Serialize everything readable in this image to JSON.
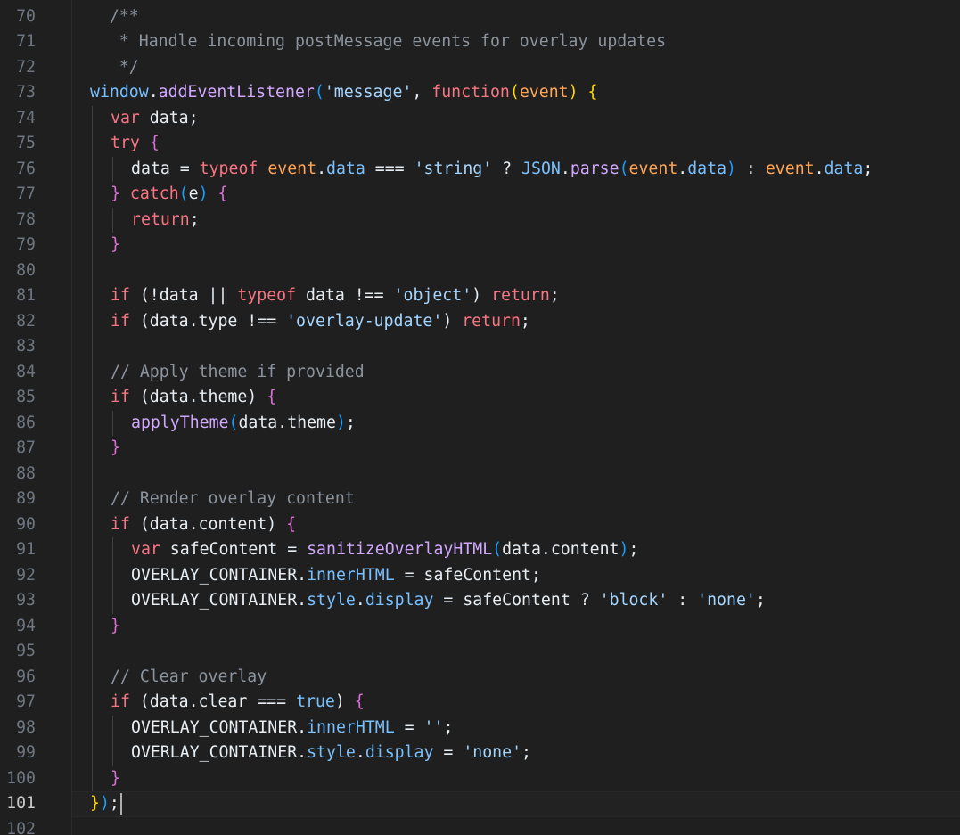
{
  "editor": {
    "lines": [
      {
        "n": "70",
        "indent": 0,
        "tokens": [
          {
            "t": "  /**",
            "c": "c-grey"
          }
        ]
      },
      {
        "n": "71",
        "indent": 0,
        "tokens": [
          {
            "t": "   * Handle incoming postMessage events for overlay updates",
            "c": "c-grey"
          }
        ]
      },
      {
        "n": "72",
        "indent": 0,
        "tokens": [
          {
            "t": "   */",
            "c": "c-grey"
          }
        ]
      },
      {
        "n": "73",
        "indent": 0,
        "tokens": [
          {
            "t": "window",
            "c": "tk-blue"
          },
          {
            "t": ".",
            "c": "tk-plain"
          },
          {
            "t": "addEventListener",
            "c": "fn-purple"
          },
          {
            "t": "(",
            "c": "b3"
          },
          {
            "t": "'message'",
            "c": "tk-str"
          },
          {
            "t": ", ",
            "c": "tk-plain"
          },
          {
            "t": "function",
            "c": "kw-red"
          },
          {
            "t": "(",
            "c": "b1"
          },
          {
            "t": "event",
            "c": "tk-orange"
          },
          {
            "t": ")",
            "c": "b1"
          },
          {
            "t": " ",
            "c": "tk-plain"
          },
          {
            "t": "{",
            "c": "b1"
          }
        ]
      },
      {
        "n": "74",
        "indent": 1,
        "tokens": [
          {
            "t": "var",
            "c": "kw-red"
          },
          {
            "t": " data;",
            "c": "tk-plain"
          }
        ]
      },
      {
        "n": "75",
        "indent": 1,
        "tokens": [
          {
            "t": "try",
            "c": "kw-red"
          },
          {
            "t": " ",
            "c": "tk-plain"
          },
          {
            "t": "{",
            "c": "b2"
          }
        ]
      },
      {
        "n": "76",
        "indent": 2,
        "tokens": [
          {
            "t": "data = ",
            "c": "tk-plain"
          },
          {
            "t": "typeof",
            "c": "kw-red"
          },
          {
            "t": " ",
            "c": "tk-plain"
          },
          {
            "t": "event",
            "c": "tk-orange"
          },
          {
            "t": ".",
            "c": "tk-plain"
          },
          {
            "t": "data",
            "c": "tk-blue"
          },
          {
            "t": " === ",
            "c": "tk-plain"
          },
          {
            "t": "'string'",
            "c": "tk-str"
          },
          {
            "t": " ? ",
            "c": "tk-plain"
          },
          {
            "t": "JSON",
            "c": "tk-blue"
          },
          {
            "t": ".",
            "c": "tk-plain"
          },
          {
            "t": "parse",
            "c": "fn-purple"
          },
          {
            "t": "(",
            "c": "b3"
          },
          {
            "t": "event",
            "c": "tk-orange"
          },
          {
            "t": ".",
            "c": "tk-plain"
          },
          {
            "t": "data",
            "c": "tk-blue"
          },
          {
            "t": ")",
            "c": "b3"
          },
          {
            "t": " : ",
            "c": "tk-plain"
          },
          {
            "t": "event",
            "c": "tk-orange"
          },
          {
            "t": ".",
            "c": "tk-plain"
          },
          {
            "t": "data",
            "c": "tk-blue"
          },
          {
            "t": ";",
            "c": "tk-plain"
          }
        ]
      },
      {
        "n": "77",
        "indent": 1,
        "tokens": [
          {
            "t": "}",
            "c": "b2"
          },
          {
            "t": " ",
            "c": "tk-plain"
          },
          {
            "t": "catch",
            "c": "kw-red"
          },
          {
            "t": "(",
            "c": "b3"
          },
          {
            "t": "e",
            "c": "tk-plain"
          },
          {
            "t": ")",
            "c": "b3"
          },
          {
            "t": " ",
            "c": "tk-plain"
          },
          {
            "t": "{",
            "c": "b2"
          }
        ]
      },
      {
        "n": "78",
        "indent": 2,
        "tokens": [
          {
            "t": "return",
            "c": "kw-red"
          },
          {
            "t": ";",
            "c": "tk-plain"
          }
        ]
      },
      {
        "n": "79",
        "indent": 1,
        "tokens": [
          {
            "t": "}",
            "c": "b2"
          }
        ]
      },
      {
        "n": "80",
        "indent": 1,
        "tokens": []
      },
      {
        "n": "81",
        "indent": 1,
        "tokens": [
          {
            "t": "if",
            "c": "kw-red"
          },
          {
            "t": " (!data || ",
            "c": "tk-plain"
          },
          {
            "t": "typeof",
            "c": "kw-red"
          },
          {
            "t": " data !== ",
            "c": "tk-plain"
          },
          {
            "t": "'object'",
            "c": "tk-str"
          },
          {
            "t": ") ",
            "c": "tk-plain"
          },
          {
            "t": "return",
            "c": "kw-red"
          },
          {
            "t": ";",
            "c": "tk-plain"
          }
        ]
      },
      {
        "n": "82",
        "indent": 1,
        "tokens": [
          {
            "t": "if",
            "c": "kw-red"
          },
          {
            "t": " (data.type !== ",
            "c": "tk-plain"
          },
          {
            "t": "'overlay-update'",
            "c": "tk-str"
          },
          {
            "t": ") ",
            "c": "tk-plain"
          },
          {
            "t": "return",
            "c": "kw-red"
          },
          {
            "t": ";",
            "c": "tk-plain"
          }
        ]
      },
      {
        "n": "83",
        "indent": 1,
        "tokens": []
      },
      {
        "n": "84",
        "indent": 1,
        "tokens": [
          {
            "t": "// Apply theme if provided",
            "c": "c-grey"
          }
        ]
      },
      {
        "n": "85",
        "indent": 1,
        "tokens": [
          {
            "t": "if",
            "c": "kw-red"
          },
          {
            "t": " (data.theme) ",
            "c": "tk-plain"
          },
          {
            "t": "{",
            "c": "b2"
          }
        ]
      },
      {
        "n": "86",
        "indent": 2,
        "tokens": [
          {
            "t": "applyTheme",
            "c": "fn-purple"
          },
          {
            "t": "(",
            "c": "b3"
          },
          {
            "t": "data.theme",
            "c": "tk-plain"
          },
          {
            "t": ")",
            "c": "b3"
          },
          {
            "t": ";",
            "c": "tk-plain"
          }
        ]
      },
      {
        "n": "87",
        "indent": 1,
        "tokens": [
          {
            "t": "}",
            "c": "b2"
          }
        ]
      },
      {
        "n": "88",
        "indent": 1,
        "tokens": []
      },
      {
        "n": "89",
        "indent": 1,
        "tokens": [
          {
            "t": "// Render overlay content",
            "c": "c-grey"
          }
        ]
      },
      {
        "n": "90",
        "indent": 1,
        "tokens": [
          {
            "t": "if",
            "c": "kw-red"
          },
          {
            "t": " (data.content) ",
            "c": "tk-plain"
          },
          {
            "t": "{",
            "c": "b2"
          }
        ]
      },
      {
        "n": "91",
        "indent": 2,
        "tokens": [
          {
            "t": "var",
            "c": "kw-red"
          },
          {
            "t": " safeContent = ",
            "c": "tk-plain"
          },
          {
            "t": "sanitizeOverlayHTML",
            "c": "fn-purple"
          },
          {
            "t": "(",
            "c": "b3"
          },
          {
            "t": "data.content",
            "c": "tk-plain"
          },
          {
            "t": ")",
            "c": "b3"
          },
          {
            "t": ";",
            "c": "tk-plain"
          }
        ]
      },
      {
        "n": "92",
        "indent": 2,
        "tokens": [
          {
            "t": "OVERLAY_CONTAINER",
            "c": "tk-plain"
          },
          {
            "t": ".",
            "c": "tk-plain"
          },
          {
            "t": "innerHTML",
            "c": "tk-blue"
          },
          {
            "t": " = safeContent;",
            "c": "tk-plain"
          }
        ]
      },
      {
        "n": "93",
        "indent": 2,
        "tokens": [
          {
            "t": "OVERLAY_CONTAINER",
            "c": "tk-plain"
          },
          {
            "t": ".",
            "c": "tk-plain"
          },
          {
            "t": "style",
            "c": "tk-blue"
          },
          {
            "t": ".",
            "c": "tk-plain"
          },
          {
            "t": "display",
            "c": "tk-blue"
          },
          {
            "t": " = safeContent ? ",
            "c": "tk-plain"
          },
          {
            "t": "'block'",
            "c": "tk-str"
          },
          {
            "t": " : ",
            "c": "tk-plain"
          },
          {
            "t": "'none'",
            "c": "tk-str"
          },
          {
            "t": ";",
            "c": "tk-plain"
          }
        ]
      },
      {
        "n": "94",
        "indent": 1,
        "tokens": [
          {
            "t": "}",
            "c": "b2"
          }
        ]
      },
      {
        "n": "95",
        "indent": 1,
        "tokens": []
      },
      {
        "n": "96",
        "indent": 1,
        "tokens": [
          {
            "t": "// Clear overlay",
            "c": "c-grey"
          }
        ]
      },
      {
        "n": "97",
        "indent": 1,
        "tokens": [
          {
            "t": "if",
            "c": "kw-red"
          },
          {
            "t": " (data.clear === ",
            "c": "tk-plain"
          },
          {
            "t": "true",
            "c": "tk-blue"
          },
          {
            "t": ") ",
            "c": "tk-plain"
          },
          {
            "t": "{",
            "c": "b2"
          }
        ]
      },
      {
        "n": "98",
        "indent": 2,
        "tokens": [
          {
            "t": "OVERLAY_CONTAINER",
            "c": "tk-plain"
          },
          {
            "t": ".",
            "c": "tk-plain"
          },
          {
            "t": "innerHTML",
            "c": "tk-blue"
          },
          {
            "t": " = ",
            "c": "tk-plain"
          },
          {
            "t": "''",
            "c": "tk-str"
          },
          {
            "t": ";",
            "c": "tk-plain"
          }
        ]
      },
      {
        "n": "99",
        "indent": 2,
        "tokens": [
          {
            "t": "OVERLAY_CONTAINER",
            "c": "tk-plain"
          },
          {
            "t": ".",
            "c": "tk-plain"
          },
          {
            "t": "style",
            "c": "tk-blue"
          },
          {
            "t": ".",
            "c": "tk-plain"
          },
          {
            "t": "display",
            "c": "tk-blue"
          },
          {
            "t": " = ",
            "c": "tk-plain"
          },
          {
            "t": "'none'",
            "c": "tk-str"
          },
          {
            "t": ";",
            "c": "tk-plain"
          }
        ]
      },
      {
        "n": "100",
        "indent": 1,
        "tokens": [
          {
            "t": "}",
            "c": "b2"
          }
        ]
      },
      {
        "n": "101",
        "indent": 0,
        "current": true,
        "tokens": [
          {
            "t": "}",
            "c": "b1"
          },
          {
            "t": ")",
            "c": "b3"
          },
          {
            "t": ";",
            "c": "tk-plain"
          }
        ]
      },
      {
        "n": "102",
        "indent": 0,
        "tokens": []
      }
    ]
  }
}
